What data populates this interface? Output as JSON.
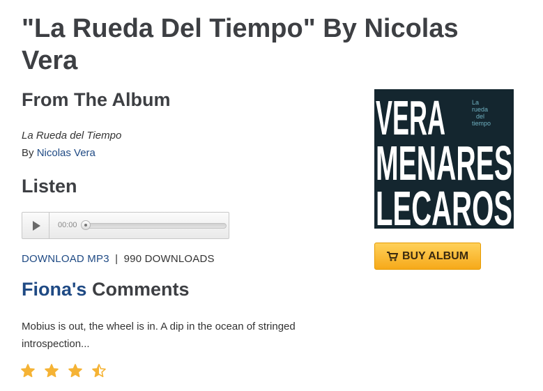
{
  "page": {
    "title": "\"La Rueda Del Tiempo\" By Nicolas Vera"
  },
  "album": {
    "heading": "From The Album",
    "name": "La Rueda del Tiempo",
    "by_prefix": "By",
    "artist": "Nicolas Vera",
    "cover_words": [
      "VERA",
      "MENARES",
      "LECAROS"
    ],
    "cover_subtitle": [
      "La",
      "rueda",
      "del",
      "tiempo"
    ],
    "buy_label": "BUY ALBUM",
    "buy_icon": "shopping-cart-icon"
  },
  "listen": {
    "heading": "Listen",
    "player": {
      "time": "00:00",
      "progress": 0,
      "play_icon": "play-icon"
    },
    "download_label": "DOWNLOAD MP3",
    "separator": "|",
    "downloads_count": "990 DOWNLOADS"
  },
  "comments": {
    "author": "Fiona's",
    "heading_suffix": "Comments",
    "text": "Mobius is out, the wheel is in. A dip in the ocean of stringed introspection...",
    "rating": 3.5,
    "rating_max": 4,
    "star_color": "#f5b335"
  },
  "colors": {
    "link": "#1f4a84",
    "heading": "#3d3f43",
    "button": "#f6a91a",
    "cover_bg": "#14262f"
  }
}
